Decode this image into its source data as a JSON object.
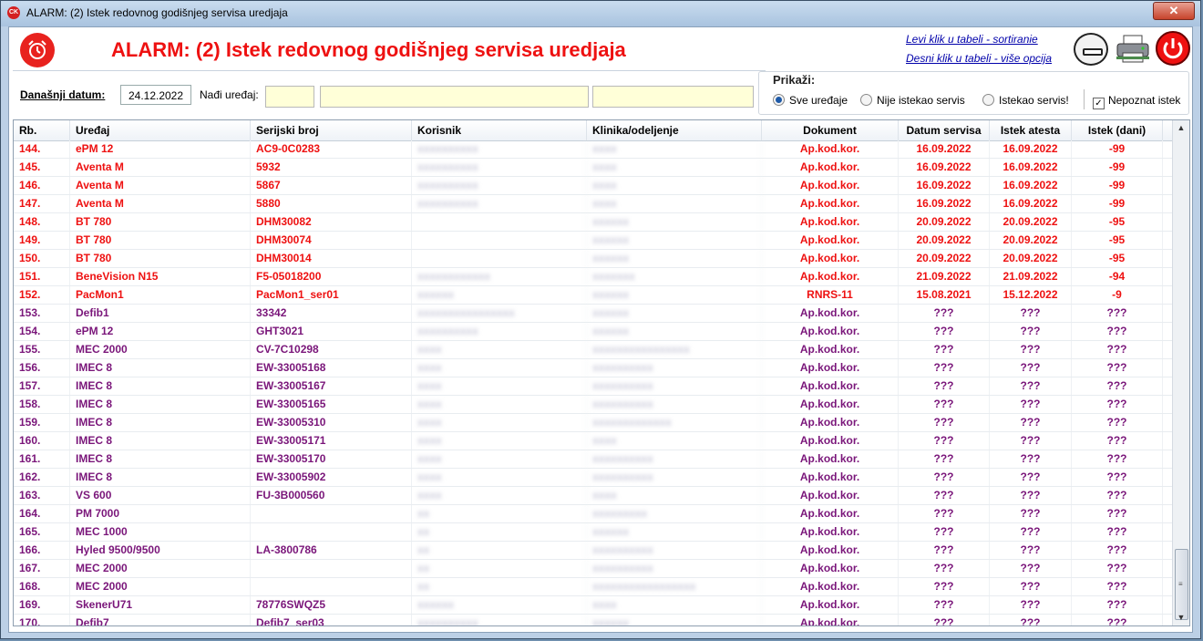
{
  "window": {
    "title": "ALARM: (2) Istek redovnog godišnjeg servisa uredjaja",
    "icon_text": "CK",
    "close_symbol": "✕"
  },
  "header": {
    "title": "ALARM: (2) Istek redovnog godišnjeg servisa uredjaja",
    "hint_left_click": "Levi klik u tabeli - sortiranie",
    "hint_right_click": "Desni klik u tabeli - više opcija"
  },
  "toolbar": {
    "date_label": "Današnji datum:",
    "date_value": "24.12.2022",
    "find_label": "Nađi uređaj:",
    "filter_title": "Prikaži:",
    "radio_all": "Sve uređaje",
    "radio_not_expired": "Nije istekao servis",
    "radio_expired": "Istekao servis!",
    "checkbox_unknown": "Nepoznat istek",
    "checkbox_mark": "✓"
  },
  "colors": {
    "title_red": "#ee1111",
    "expired_red": "#ee1111",
    "unknown_purple": "#7a167a"
  },
  "table": {
    "columns": [
      "Rb.",
      "Uređaj",
      "Serijski broj",
      "Korisnik",
      "Klinika/odeljenje",
      "Dokument",
      "Datum servisa",
      "Istek atesta",
      "Istek (dani)"
    ],
    "rows": [
      {
        "rb": "144.",
        "device": "ePM 12",
        "serial": "AC9-0C0283",
        "user": "xxxxxxxxxx",
        "clinic": "xxxx",
        "doc": "Ap.kod.kor.",
        "service": "16.09.2022",
        "expiry": "16.09.2022",
        "days": "-99",
        "status": "expired"
      },
      {
        "rb": "145.",
        "device": "Aventa M",
        "serial": "5932",
        "user": "xxxxxxxxxx",
        "clinic": "xxxx",
        "doc": "Ap.kod.kor.",
        "service": "16.09.2022",
        "expiry": "16.09.2022",
        "days": "-99",
        "status": "expired"
      },
      {
        "rb": "146.",
        "device": "Aventa M",
        "serial": "5867",
        "user": "xxxxxxxxxx",
        "clinic": "xxxx",
        "doc": "Ap.kod.kor.",
        "service": "16.09.2022",
        "expiry": "16.09.2022",
        "days": "-99",
        "status": "expired"
      },
      {
        "rb": "147.",
        "device": "Aventa M",
        "serial": "5880",
        "user": "xxxxxxxxxx",
        "clinic": "xxxx",
        "doc": "Ap.kod.kor.",
        "service": "16.09.2022",
        "expiry": "16.09.2022",
        "days": "-99",
        "status": "expired"
      },
      {
        "rb": "148.",
        "device": "BT 780",
        "serial": "DHM30082",
        "user": "",
        "clinic": "xxxxxx",
        "doc": "Ap.kod.kor.",
        "service": "20.09.2022",
        "expiry": "20.09.2022",
        "days": "-95",
        "status": "expired"
      },
      {
        "rb": "149.",
        "device": "BT 780",
        "serial": "DHM30074",
        "user": "",
        "clinic": "xxxxxx",
        "doc": "Ap.kod.kor.",
        "service": "20.09.2022",
        "expiry": "20.09.2022",
        "days": "-95",
        "status": "expired"
      },
      {
        "rb": "150.",
        "device": "BT 780",
        "serial": "DHM30014",
        "user": "",
        "clinic": "xxxxxx",
        "doc": "Ap.kod.kor.",
        "service": "20.09.2022",
        "expiry": "20.09.2022",
        "days": "-95",
        "status": "expired"
      },
      {
        "rb": "151.",
        "device": "BeneVision N15",
        "serial": "F5-05018200",
        "user": "xxxxxxxxxxxx",
        "clinic": "xxxxxxx",
        "doc": "Ap.kod.kor.",
        "service": "21.09.2022",
        "expiry": "21.09.2022",
        "days": "-94",
        "status": "expired"
      },
      {
        "rb": "152.",
        "device": "PacMon1",
        "serial": "PacMon1_ser01",
        "user": "xxxxxx",
        "clinic": "xxxxxx",
        "doc": "RNRS-11",
        "service": "15.08.2021",
        "expiry": "15.12.2022",
        "days": "-9",
        "status": "expired"
      },
      {
        "rb": "153.",
        "device": "Defib1",
        "serial": "33342",
        "user": "xxxxxxxxxxxxxxxx",
        "clinic": "xxxxxx",
        "doc": "Ap.kod.kor.",
        "service": "???",
        "expiry": "???",
        "days": "???",
        "status": "unknown"
      },
      {
        "rb": "154.",
        "device": "ePM 12",
        "serial": "GHT3021",
        "user": "xxxxxxxxxx",
        "clinic": "xxxxxx",
        "doc": "Ap.kod.kor.",
        "service": "???",
        "expiry": "???",
        "days": "???",
        "status": "unknown"
      },
      {
        "rb": "155.",
        "device": "MEC 2000",
        "serial": "CV-7C10298",
        "user": "xxxx",
        "clinic": "xxxxxxxxxxxxxxxx",
        "doc": "Ap.kod.kor.",
        "service": "???",
        "expiry": "???",
        "days": "???",
        "status": "unknown"
      },
      {
        "rb": "156.",
        "device": "IMEC 8",
        "serial": "EW-33005168",
        "user": "xxxx",
        "clinic": "xxxxxxxxxx",
        "doc": "Ap.kod.kor.",
        "service": "???",
        "expiry": "???",
        "days": "???",
        "status": "unknown"
      },
      {
        "rb": "157.",
        "device": "IMEC 8",
        "serial": "EW-33005167",
        "user": "xxxx",
        "clinic": "xxxxxxxxxx",
        "doc": "Ap.kod.kor.",
        "service": "???",
        "expiry": "???",
        "days": "???",
        "status": "unknown"
      },
      {
        "rb": "158.",
        "device": "IMEC 8",
        "serial": "EW-33005165",
        "user": "xxxx",
        "clinic": "xxxxxxxxxx",
        "doc": "Ap.kod.kor.",
        "service": "???",
        "expiry": "???",
        "days": "???",
        "status": "unknown"
      },
      {
        "rb": "159.",
        "device": "IMEC 8",
        "serial": "EW-33005310",
        "user": "xxxx",
        "clinic": "xxxxxxxxxxxxx",
        "doc": "Ap.kod.kor.",
        "service": "???",
        "expiry": "???",
        "days": "???",
        "status": "unknown"
      },
      {
        "rb": "160.",
        "device": "IMEC 8",
        "serial": "EW-33005171",
        "user": "xxxx",
        "clinic": "xxxx",
        "doc": "Ap.kod.kor.",
        "service": "???",
        "expiry": "???",
        "days": "???",
        "status": "unknown"
      },
      {
        "rb": "161.",
        "device": "IMEC 8",
        "serial": "EW-33005170",
        "user": "xxxx",
        "clinic": "xxxxxxxxxx",
        "doc": "Ap.kod.kor.",
        "service": "???",
        "expiry": "???",
        "days": "???",
        "status": "unknown"
      },
      {
        "rb": "162.",
        "device": "IMEC 8",
        "serial": "EW-33005902",
        "user": "xxxx",
        "clinic": "xxxxxxxxxx",
        "doc": "Ap.kod.kor.",
        "service": "???",
        "expiry": "???",
        "days": "???",
        "status": "unknown"
      },
      {
        "rb": "163.",
        "device": "VS 600",
        "serial": "FU-3B000560",
        "user": "xxxx",
        "clinic": "xxxx",
        "doc": "Ap.kod.kor.",
        "service": "???",
        "expiry": "???",
        "days": "???",
        "status": "unknown"
      },
      {
        "rb": "164.",
        "device": "PM 7000",
        "serial": "",
        "user": "xx",
        "clinic": "xxxxxxxxx",
        "doc": "Ap.kod.kor.",
        "service": "???",
        "expiry": "???",
        "days": "???",
        "status": "unknown"
      },
      {
        "rb": "165.",
        "device": "MEC 1000",
        "serial": "",
        "user": "xx",
        "clinic": "xxxxxx",
        "doc": "Ap.kod.kor.",
        "service": "???",
        "expiry": "???",
        "days": "???",
        "status": "unknown"
      },
      {
        "rb": "166.",
        "device": "Hyled 9500/9500",
        "serial": "LA-3800786",
        "user": "xx",
        "clinic": "xxxxxxxxxx",
        "doc": "Ap.kod.kor.",
        "service": "???",
        "expiry": "???",
        "days": "???",
        "status": "unknown"
      },
      {
        "rb": "167.",
        "device": "MEC 2000",
        "serial": "",
        "user": "xx",
        "clinic": "xxxxxxxxxx",
        "doc": "Ap.kod.kor.",
        "service": "???",
        "expiry": "???",
        "days": "???",
        "status": "unknown"
      },
      {
        "rb": "168.",
        "device": "MEC 2000",
        "serial": "",
        "user": "xx",
        "clinic": "xxxxxxxxxxxxxxxxx",
        "doc": "Ap.kod.kor.",
        "service": "???",
        "expiry": "???",
        "days": "???",
        "status": "unknown"
      },
      {
        "rb": "169.",
        "device": "SkenerU71",
        "serial": "78776SWQZ5",
        "user": "xxxxxx",
        "clinic": "xxxx",
        "doc": "Ap.kod.kor.",
        "service": "???",
        "expiry": "???",
        "days": "???",
        "status": "unknown"
      },
      {
        "rb": "170.",
        "device": "Defib7",
        "serial": "Defib7_ser03",
        "user": "xxxxxxxxxx",
        "clinic": "xxxxxx",
        "doc": "Ap.kod.kor.",
        "service": "???",
        "expiry": "???",
        "days": "???",
        "status": "unknown"
      }
    ]
  }
}
